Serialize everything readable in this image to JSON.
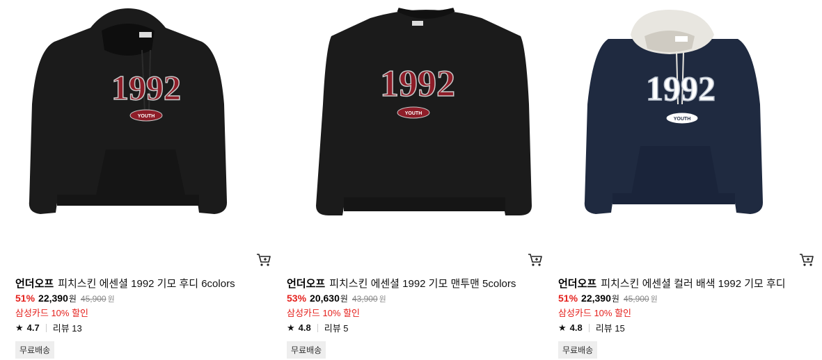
{
  "products": [
    {
      "brand": "언더오프",
      "name": "피치스킨 에센셜 1992 기모 후디 6colors",
      "discount": "51%",
      "price": "22,390",
      "price_unit": "원",
      "original_price": "45,900",
      "original_unit": "원",
      "promo": "삼성카드 10% 할인",
      "rating": "4.7",
      "review_label": "리뷰 13",
      "badge": "무료배송",
      "graphic_number": "1992",
      "graphic_text": "YOUTH",
      "colors": {
        "body": "#1b1b1b",
        "accent": "#8e1d28",
        "hood": "#1b1b1b"
      },
      "icons": {
        "cart": "cart-icon",
        "star": "star-icon"
      }
    },
    {
      "brand": "언더오프",
      "name": "피치스킨 에센셜 1992 기모 맨투맨 5colors",
      "discount": "53%",
      "price": "20,630",
      "price_unit": "원",
      "original_price": "43,900",
      "original_unit": "원",
      "promo": "삼성카드 10% 할인",
      "rating": "4.8",
      "review_label": "리뷰 5",
      "badge": "무료배송",
      "graphic_number": "1992",
      "graphic_text": "YOUTH",
      "colors": {
        "body": "#1b1b1b",
        "accent": "#8e1d28"
      },
      "icons": {
        "cart": "cart-icon",
        "star": "star-icon"
      }
    },
    {
      "brand": "언더오프",
      "name": "피치스킨 에센셜 컬러 배색 1992 기모 후디",
      "discount": "51%",
      "price": "22,390",
      "price_unit": "원",
      "original_price": "45,900",
      "original_unit": "원",
      "promo": "삼성카드 10% 할인",
      "rating": "4.8",
      "review_label": "리뷰 15",
      "badge": "무료배송",
      "graphic_number": "1992",
      "graphic_text": "YOUTH",
      "colors": {
        "body": "#1f2a40",
        "accent": "#ffffff",
        "hood": "#e8e6e0"
      },
      "icons": {
        "cart": "cart-icon",
        "star": "star-icon"
      }
    }
  ]
}
